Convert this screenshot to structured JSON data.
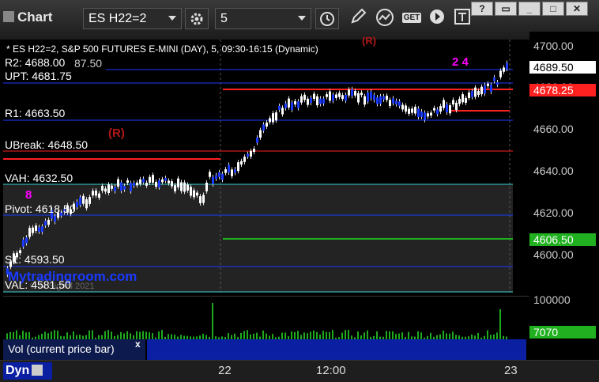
{
  "app": {
    "title": "Chart"
  },
  "toolbar": {
    "symbol": "ES H22=2",
    "interval": "5",
    "get_label": "GET"
  },
  "chart": {
    "header": "* ES H22=2, S&P 500 FUTURES E-MINI (DAY), 5, 09:30-16:15 (Dynamic)",
    "watermark": "Mytradingroom.com",
    "watermark_small": "© Ai Signal 2021",
    "r_marker": "(R)",
    "marker_8": "8",
    "marker_24": "2 4",
    "ref_87": "87.50"
  },
  "levels": [
    {
      "label": "R2: 4688.00",
      "color": "#1a3aff"
    },
    {
      "label": "UPT: 4681.75",
      "color": "#1a3aff"
    },
    {
      "label": "R1: 4663.50",
      "color": "#1a3aff"
    },
    {
      "label": "UBreak: 4648.50",
      "color": "#ff2020"
    },
    {
      "label": "VAH: 4632.50",
      "color": "#30d0d0"
    },
    {
      "label": "Pivot: 4618.50",
      "color": "#1a3aff"
    },
    {
      "label": "S1: 4593.50",
      "color": "#1a3aff"
    },
    {
      "label": "VAL: 4581.50",
      "color": "#30d0d0"
    }
  ],
  "price_axis": {
    "ticks": [
      "4700.00",
      "4680.00",
      "4660.00",
      "4640.00",
      "4620.00",
      "4600.00"
    ],
    "last_price": "4689.50",
    "red_label": "4678.25",
    "green_label": "4606.50"
  },
  "volume": {
    "tag": "Vol (current price bar)",
    "close": "x",
    "axis_top": "100000",
    "last_volume": "7070"
  },
  "time_axis": {
    "labels": [
      "22",
      "12:00",
      "23"
    ]
  },
  "bottom": {
    "dyn": "Dyn"
  }
}
